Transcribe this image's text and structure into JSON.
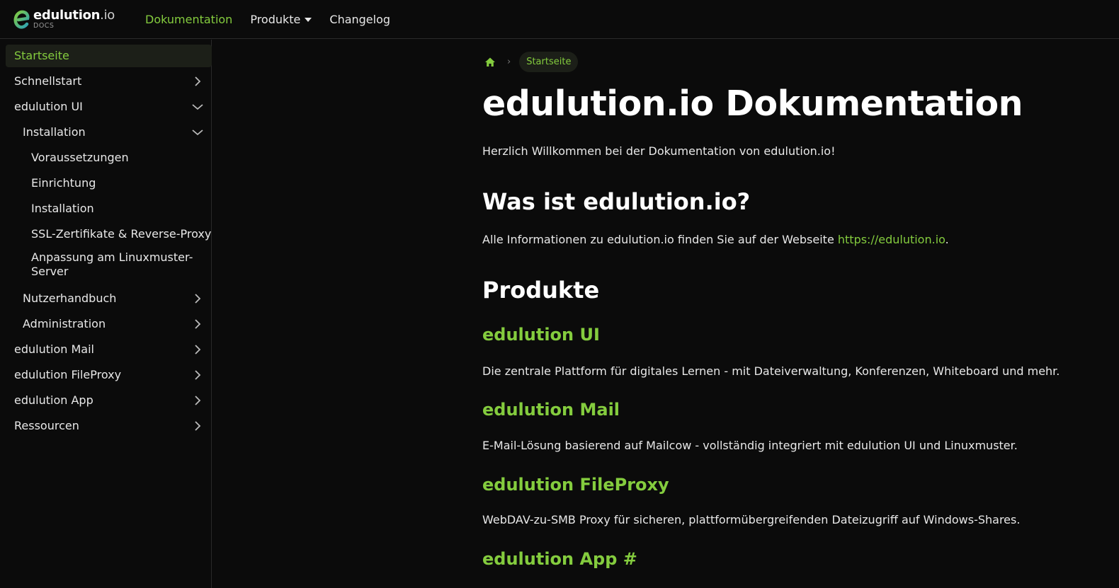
{
  "navbar": {
    "logo": {
      "name_main": "edulution",
      "name_suffix": ".io",
      "sub": "DOCS"
    },
    "links": [
      {
        "label": "Dokumentation",
        "active": true
      },
      {
        "label": "Produkte",
        "dropdown": true
      },
      {
        "label": "Changelog"
      }
    ]
  },
  "sidebar": {
    "items": [
      {
        "label": "Startseite",
        "active": true
      },
      {
        "label": "Schnellstart",
        "chevron": "right"
      },
      {
        "label": "edulution UI",
        "chevron": "down"
      },
      {
        "label": "Installation",
        "chevron": "down"
      },
      {
        "label": "Voraussetzungen"
      },
      {
        "label": "Einrichtung"
      },
      {
        "label": "Installation"
      },
      {
        "label": "SSL-Zertifikate & Reverse-Proxy"
      },
      {
        "label_line1": "Anpassung am Linuxmuster-",
        "label_line2": "Server"
      },
      {
        "label": "Nutzerhandbuch",
        "chevron": "right"
      },
      {
        "label": "Administration",
        "chevron": "right"
      },
      {
        "label": "edulution Mail",
        "chevron": "right"
      },
      {
        "label": "edulution FileProxy",
        "chevron": "right"
      },
      {
        "label": "edulution App",
        "chevron": "right"
      },
      {
        "label": "Ressourcen",
        "chevron": "right"
      }
    ]
  },
  "breadcrumb": {
    "current": "Startseite"
  },
  "content": {
    "title": "edulution.io Dokumentation",
    "intro": "Herzlich Willkommen bei der Dokumentation von edulution.io!",
    "section_what": {
      "heading": "Was ist edulution.io?",
      "text_before": "Alle Informationen zu edulution.io finden Sie auf der Webseite ",
      "link": "https://edulution.io",
      "text_after": "."
    },
    "section_products": {
      "heading": "Produkte",
      "items": [
        {
          "name": "edulution UI",
          "desc": "Die zentrale Plattform für digitales Lernen - mit Dateiverwaltung, Konferenzen, Whiteboard und mehr."
        },
        {
          "name": "edulution Mail",
          "desc": "E-Mail-Lösung basierend auf Mailcow - vollständig integriert mit edulution UI und Linuxmuster."
        },
        {
          "name": "edulution FileProxy",
          "desc": "WebDAV-zu-SMB Proxy für sicheren, plattformübergreifenden Dateizugriff auf Windows-Shares."
        },
        {
          "name": "edulution App #"
        }
      ]
    }
  },
  "colors": {
    "accent": "#84cc3e",
    "background": "#0b0b0b",
    "text": "#e8e8e8",
    "heading": "#ffffff"
  },
  "icons": [
    "edulution-logo-icon",
    "home-icon",
    "chevron-right-icon",
    "chevron-down-icon",
    "caret-down-icon"
  ]
}
